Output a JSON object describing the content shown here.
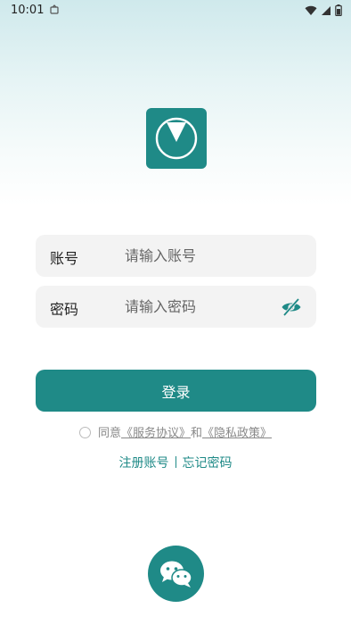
{
  "status_bar": {
    "time": "10:01"
  },
  "login": {
    "account_label": "账号",
    "account_placeholder": "请输入账号",
    "password_label": "密码",
    "password_placeholder": "请输入密码",
    "login_button": "登录"
  },
  "agreement": {
    "prefix": "同意",
    "service_link": "《服务协议》",
    "and": "和",
    "privacy_link": "《隐私政策》"
  },
  "links": {
    "register": "注册账号",
    "forgot": "忘记密码"
  },
  "icons": {
    "logo": "app-logo-icon",
    "eye": "eye-off-icon",
    "wechat": "wechat-icon"
  },
  "colors": {
    "primary": "#1f8a87",
    "field_bg": "#f3f3f3"
  }
}
